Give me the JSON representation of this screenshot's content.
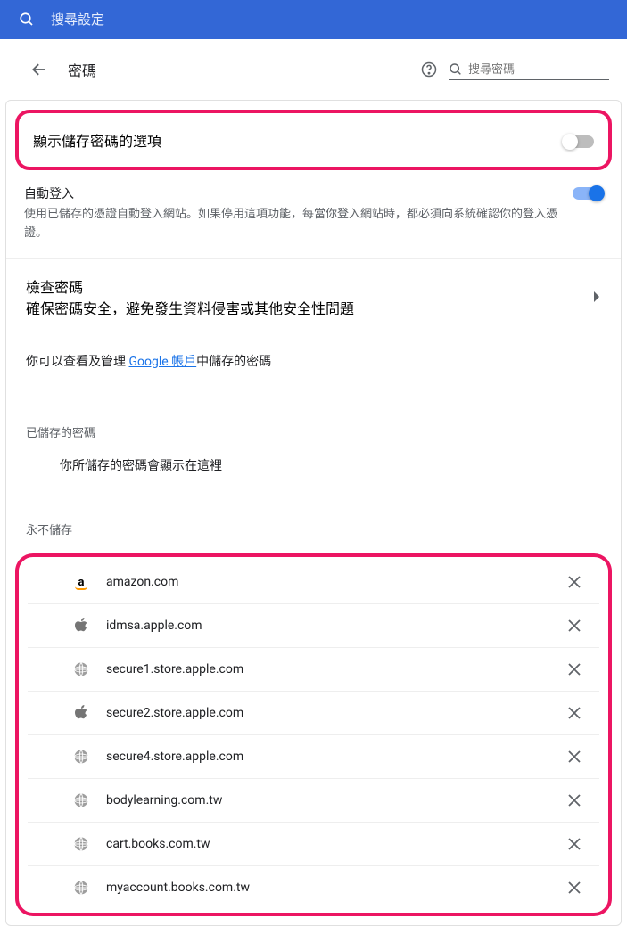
{
  "header": {
    "search_placeholder": "搜尋設定"
  },
  "page": {
    "title": "密碼",
    "search_placeholder": "搜尋密碼"
  },
  "offer_save": {
    "label": "顯示儲存密碼的選項",
    "on": false
  },
  "autosignin": {
    "label": "自動登入",
    "desc": "使用已儲存的憑證自動登入網站。如果停用這項功能，每當你登入網站時，都必須向系統確認你的登入憑證。",
    "on": true
  },
  "check": {
    "label": "檢查密碼",
    "desc": "確保密碼安全，避免發生資料侵害或其他安全性問題"
  },
  "manage": {
    "prefix": "你可以查看及管理 ",
    "link": "Google 帳戶",
    "suffix": "中儲存的密碼"
  },
  "saved": {
    "header": "已儲存的密碼",
    "empty": "你所儲存的密碼會顯示在這裡"
  },
  "never": {
    "header": "永不儲存",
    "sites": [
      {
        "icon": "amazon",
        "domain": "amazon.com"
      },
      {
        "icon": "apple",
        "domain": "idmsa.apple.com"
      },
      {
        "icon": "globe",
        "domain": "secure1.store.apple.com"
      },
      {
        "icon": "apple",
        "domain": "secure2.store.apple.com"
      },
      {
        "icon": "globe",
        "domain": "secure4.store.apple.com"
      },
      {
        "icon": "globe",
        "domain": "bodylearning.com.tw"
      },
      {
        "icon": "globe",
        "domain": "cart.books.com.tw"
      },
      {
        "icon": "globe",
        "domain": "myaccount.books.com.tw"
      }
    ]
  }
}
